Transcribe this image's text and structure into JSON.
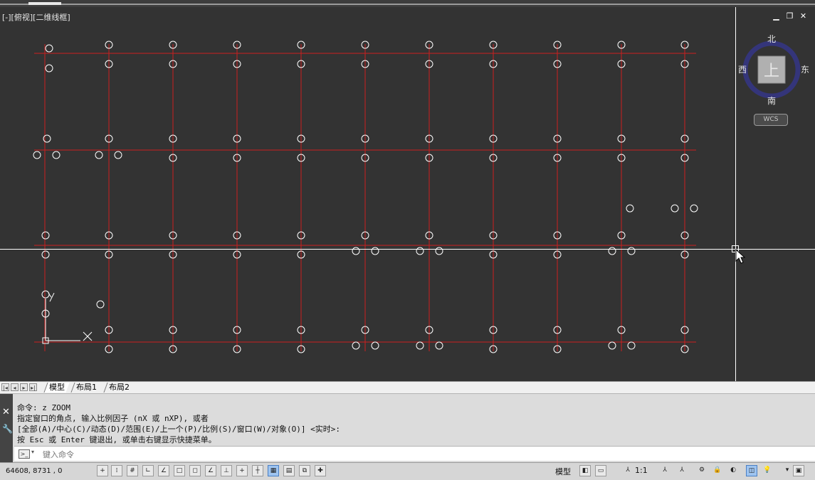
{
  "viewport": {
    "label": "[-][俯视][二维线框]",
    "win_controls": [
      "minimize-icon",
      "restore-icon",
      "close-icon"
    ]
  },
  "viewcube": {
    "north": "北",
    "south": "南",
    "east": "东",
    "west": "西",
    "face": "上",
    "wcs_label": "WCS"
  },
  "layout_tabs": {
    "tabs": [
      "模型",
      "布局1",
      "布局2"
    ],
    "active": "模型"
  },
  "command": {
    "history": [
      "命令: z ZOOM",
      "指定窗口的角点, 输入比例因子 (nX 或 nXP), 或者",
      "[全部(A)/中心(C)/动态(D)/范围(E)/上一个(P)/比例(S)/窗口(W)/对象(O)] <实时>:",
      "按 Esc 或 Enter 键退出, 或单击右键显示快捷菜单。"
    ],
    "placeholder": "键入命令"
  },
  "status": {
    "coordinates": "64608, 8731 , 0",
    "model_label": "模型",
    "annotation_scale": "1:1"
  },
  "colors": {
    "background": "#333333",
    "grid_lines": "#cc1f1f",
    "circles": "#ffffff",
    "crosshair": "#ffffff"
  }
}
